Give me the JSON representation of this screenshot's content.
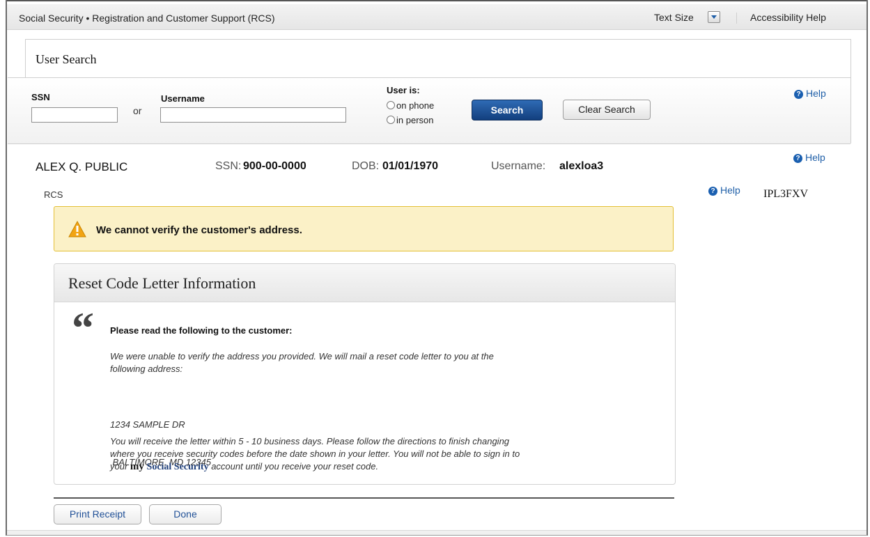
{
  "header": {
    "app_title": "Social Security • Registration and Customer Support (RCS)",
    "text_size_label": "Text Size",
    "accessibility_help": "Accessibility Help"
  },
  "search_panel": {
    "title": "User Search",
    "ssn_label": "SSN",
    "ssn_value": "",
    "or_label": "or",
    "username_label": "Username",
    "username_value": "",
    "user_is_label": "User is:",
    "options": [
      "on phone",
      "in person"
    ],
    "search_button": "Search",
    "clear_button": "Clear Search",
    "help": "Help"
  },
  "customer": {
    "name": "ALEX Q. PUBLIC",
    "ssn_label": "SSN:",
    "ssn": "900-00-0000",
    "dob_label": "DOB:",
    "dob": "01/01/1970",
    "username_label": "Username:",
    "username": "alexloa3",
    "help": "Help",
    "rcs_label": "RCS",
    "code_help": "Help",
    "code": "IPL3FXV"
  },
  "warning": {
    "message": "We cannot verify the customer's address.",
    "color": "#fbf1c7"
  },
  "letter_card": {
    "title": "Reset Code Letter Information",
    "instruction": "Please read the following to the customer:",
    "paragraph1_line1": "We were unable to verify the address you provided.  We will mail a reset code letter to you at the",
    "paragraph1_line2": "following address:",
    "address_line1": "1234 SAMPLE DR",
    "address_line2": " BALTIMORE, MD 12345",
    "paragraph2_line1": "You will receive the letter within 5 - 10 business days. Please follow the directions to finish changing",
    "paragraph2_line2": "where you receive security codes before the date shown in your letter. You will not be able to sign in to",
    "paragraph2_pre": "your ",
    "brand_my": "my",
    "brand_ss": "Social Security",
    "paragraph2_post": " account until you receive your reset code."
  },
  "actions": {
    "print_receipt": "Print Receipt",
    "done": "Done"
  },
  "colors": {
    "accent": "#1f5fa8",
    "primary_button": "#123f7e",
    "warning_border": "#e3bf35"
  }
}
